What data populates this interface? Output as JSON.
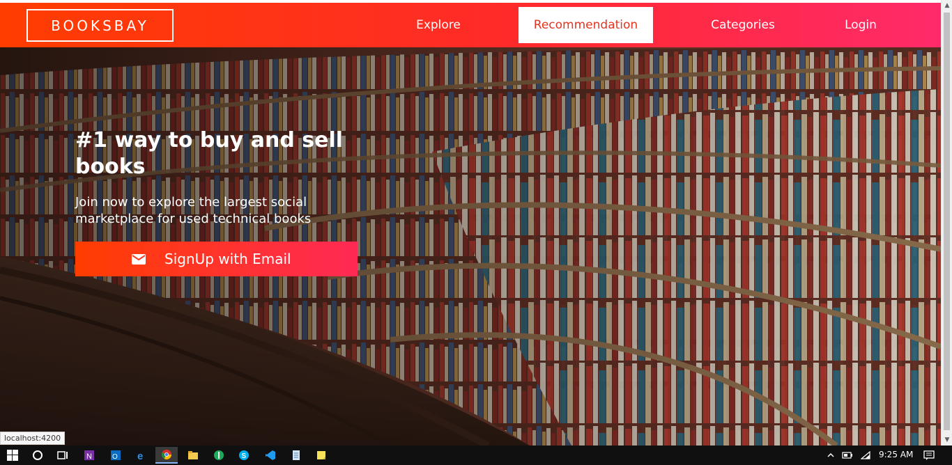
{
  "navbar": {
    "brand": "BOOKSBAY",
    "links": [
      {
        "label": "Explore",
        "active": false
      },
      {
        "label": "Recommendation",
        "active": true
      },
      {
        "label": "Categories",
        "active": false
      },
      {
        "label": "Login",
        "active": false
      }
    ]
  },
  "hero": {
    "headline": "#1 way to buy and sell books",
    "subhead": "Join now to explore the largest social marketplace for used technical books",
    "cta_label": "SignUp with Email",
    "cta_icon": "envelope-icon"
  },
  "status_bar": {
    "url": "localhost:4200"
  },
  "taskbar": {
    "apps": [
      "windows-start-icon",
      "cortana-icon",
      "task-view-icon",
      "onenote-icon",
      "outlook-icon",
      "edge-icon",
      "chrome-icon",
      "file-explorer-icon",
      "app-green-icon",
      "skype-icon",
      "vscode-icon",
      "notepad-icon",
      "sticky-notes-icon"
    ],
    "clock": "9:25 AM"
  },
  "colors": {
    "brand_gradient_start": "#ff3d00",
    "brand_gradient_end": "#ff2a6a",
    "active_link_text": "#e5331f"
  }
}
